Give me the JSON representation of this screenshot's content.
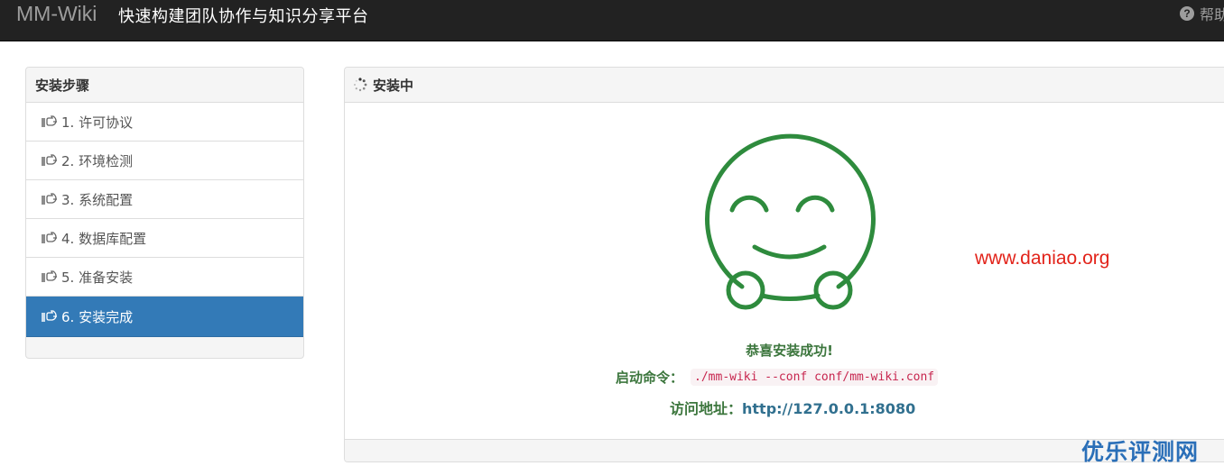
{
  "navbar": {
    "brand": "MM-Wiki",
    "tagline": "快速构建团队协作与知识分享平台",
    "help_label": "帮助"
  },
  "steps": {
    "title": "安装步骤",
    "items": [
      {
        "label": "1. 许可协议"
      },
      {
        "label": "2. 环境检测"
      },
      {
        "label": "3. 系统配置"
      },
      {
        "label": "4. 数据库配置"
      },
      {
        "label": "5. 准备安装"
      },
      {
        "label": "6. 安装完成",
        "active": true
      }
    ]
  },
  "main": {
    "title": "安装中",
    "success_message": "恭喜安装成功!",
    "start_label": "启动命令：",
    "start_command": "./mm-wiki --conf conf/mm-wiki.conf",
    "url_label": "访问地址：",
    "url_value": "http://127.0.0.1:8080"
  },
  "watermarks": {
    "site": "www.daniao.org",
    "logo": "优乐评测网"
  },
  "colors": {
    "navbar_bg": "#222222",
    "active_step": "#337ab7",
    "smiley": "#2e8b3d",
    "success_text": "#3c763d",
    "watermark_red": "#e2231a",
    "watermark_blue": "#2a6fb8"
  },
  "icons": {
    "help": "question-circle-icon",
    "step": "hand-pointing-right-icon",
    "loading": "spinner-icon",
    "illustration": "smiley-face-icon"
  }
}
